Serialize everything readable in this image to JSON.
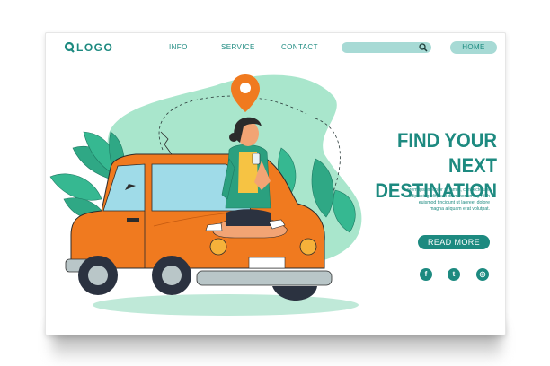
{
  "header": {
    "logo_text": "LOGO",
    "nav": [
      "INFO",
      "SERVICE",
      "CONTACT"
    ],
    "search": {
      "placeholder": "",
      "icon": "search-icon"
    },
    "home_label": "HOME"
  },
  "hero": {
    "headline_line1": "FIND YOUR NEXT",
    "headline_line2": "DESTINATION",
    "body_lines": [
      "Lorem ipsum dolor sit amet, consectetuer",
      "adipiscing elit, sed diam nonummy nibh",
      "euismod tincidunt ut laoreet dolore",
      "magna aliquam erat volutpat."
    ],
    "cta_label": "READ MORE"
  },
  "social": [
    {
      "icon": "facebook-icon",
      "glyph": "f"
    },
    {
      "icon": "twitter-icon",
      "glyph": "t"
    },
    {
      "icon": "instagram-icon",
      "glyph": "◎"
    }
  ],
  "colors": {
    "accent": "#1d8a80",
    "light_accent": "#a7dad5",
    "blob": "#9ee2c6",
    "car": "#f07a1f",
    "pin": "#f07a1f"
  }
}
